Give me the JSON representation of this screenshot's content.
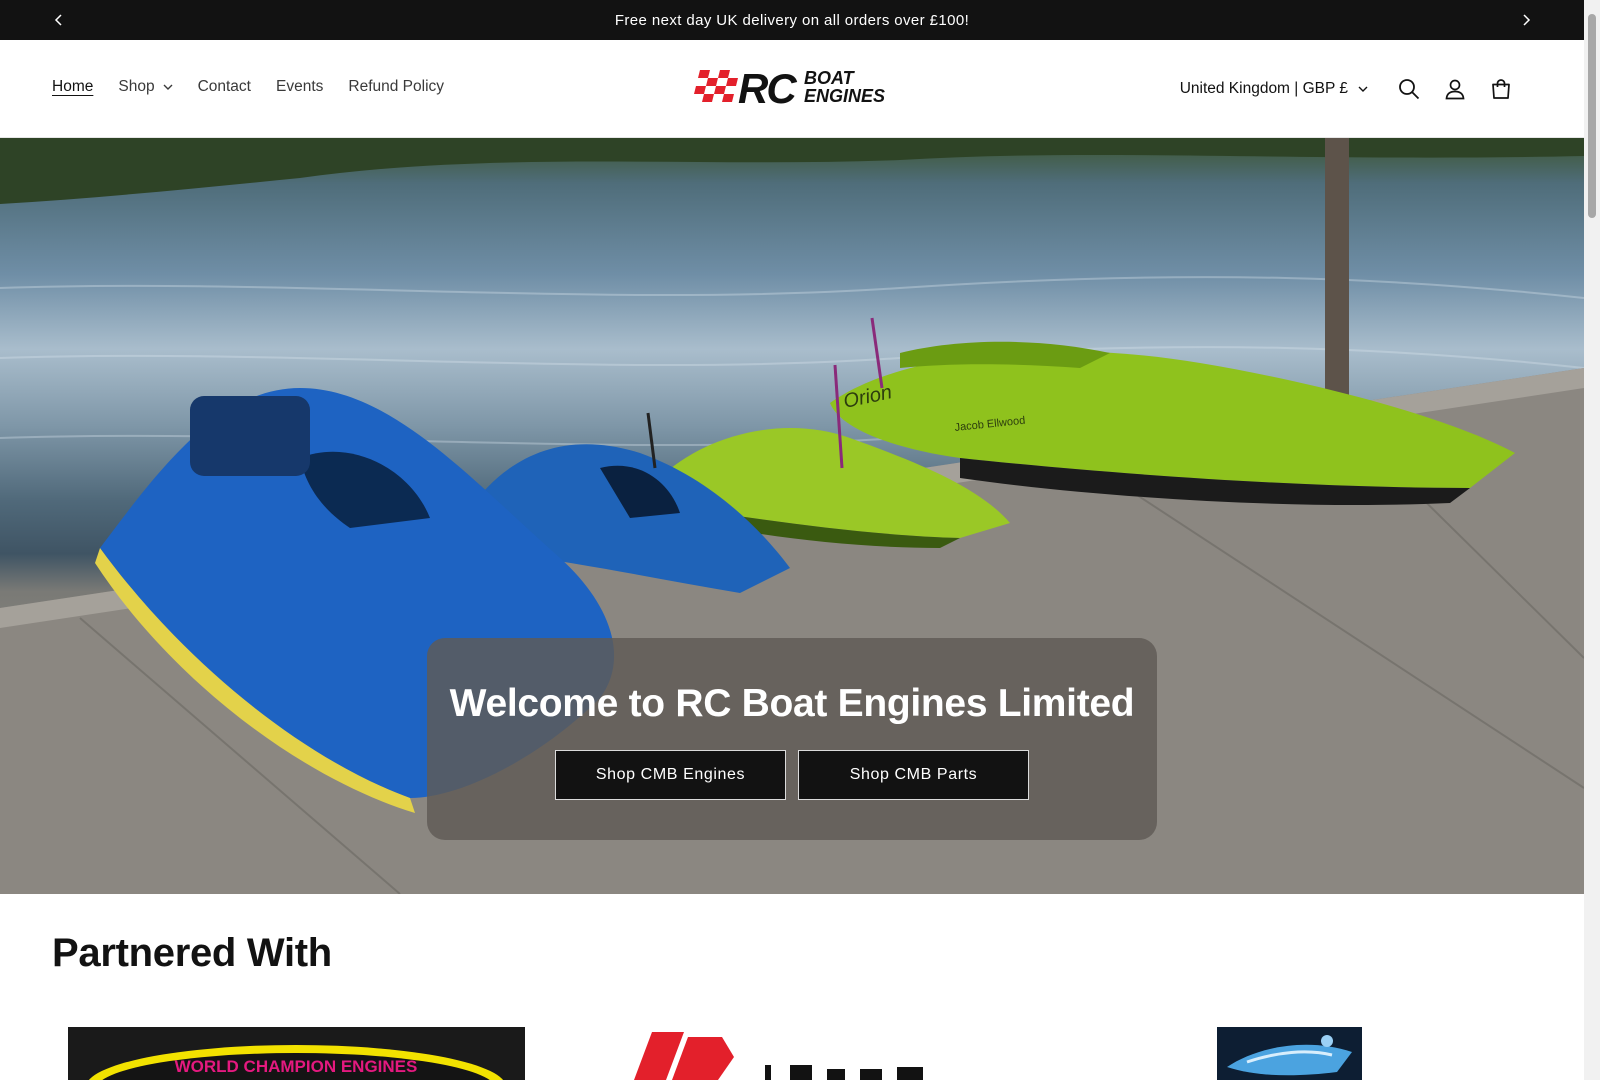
{
  "announcement": {
    "text": "Free next day UK delivery on all orders over £100!"
  },
  "nav": {
    "items": [
      {
        "label": "Home"
      },
      {
        "label": "Shop"
      },
      {
        "label": "Contact"
      },
      {
        "label": "Events"
      },
      {
        "label": "Refund Policy"
      }
    ]
  },
  "logo": {
    "rc": "RC",
    "boat": "BOAT",
    "engines": "ENGINES"
  },
  "header": {
    "country_selector": "United Kingdom | GBP £",
    "icons": [
      "search-icon",
      "account-icon",
      "cart-icon"
    ]
  },
  "hero": {
    "title": "Welcome to RC Boat Engines Limited",
    "buttons": [
      {
        "label": "Shop CMB Engines"
      },
      {
        "label": "Shop CMB Parts"
      }
    ],
    "boat_markings": [
      "Orion",
      "Jacob Ellwood"
    ]
  },
  "partners": {
    "title": "Partnered With",
    "logo_text": [
      "WORLD CHAMPION ENGINES"
    ]
  },
  "colors": {
    "bar_bg": "#121212",
    "button_bg": "#121212",
    "logo_red": "#e3202b",
    "text": "#121212"
  }
}
